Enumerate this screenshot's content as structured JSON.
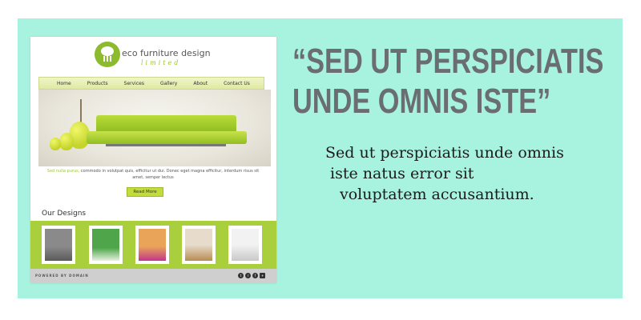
{
  "colors": {
    "panel_bg": "#a8f3df",
    "accent_green": "#a9cf3d",
    "quote_gray": "#6a6e70"
  },
  "mockup": {
    "logo": {
      "title": "eco furniture design",
      "subtitle": "limited",
      "icon": "tree-icon"
    },
    "nav": [
      "Home",
      "Products",
      "Services",
      "Gallery",
      "About",
      "Contact Us"
    ],
    "hero": {
      "highlight": "Sed nulla purus,",
      "text": "commodo in volutpat quis, efficitur ut dui. Donec eget magna efficitur, interdum risus sit amet, semper lectus",
      "button": "Read More"
    },
    "designs_heading": "Our Designs",
    "footer": {
      "text": "POWERED BY DOMAIN",
      "social_icons": [
        "twitter-icon",
        "rss-icon",
        "facebook-icon",
        "share-icon"
      ]
    }
  },
  "quote": {
    "line1": "“SED UT PERSPICIATIS",
    "line2": "UNDE OMNIS ISTE”"
  },
  "body": {
    "line1": "Sed ut perspiciatis unde omnis",
    "line2": "iste natus error sit",
    "line3": "voluptatem accusantium."
  }
}
